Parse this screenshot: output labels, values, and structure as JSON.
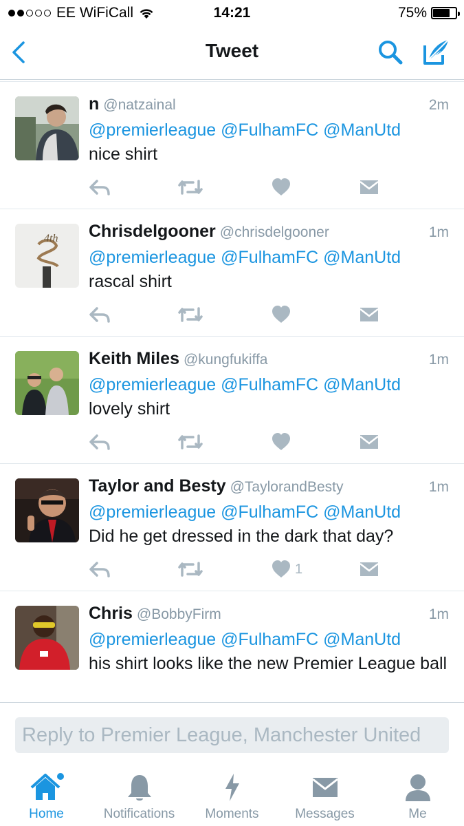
{
  "status_bar": {
    "carrier": "EE WiFiCall",
    "time": "14:21",
    "battery": "75%",
    "battery_level": 0.75,
    "signal_bars_filled": 2,
    "signal_bars_total": 5
  },
  "nav": {
    "title": "Tweet",
    "back_icon": "chevron-left-icon",
    "search_icon": "search-icon",
    "compose_icon": "compose-icon"
  },
  "colors": {
    "accent": "#1b95e0",
    "secondary_text": "#8899a6",
    "icon_gray": "#aab8c2"
  },
  "tweets": [
    {
      "name": "n",
      "handle": "@natzainal",
      "time": "2m",
      "mentions": "@premierleague @FulhamFC @ManUtd",
      "text": "nice shirt",
      "likes": ""
    },
    {
      "name": "Chrisdelgooner",
      "handle": "@chrisdelgooner",
      "time": "1m",
      "mentions": "@premierleague @FulhamFC @ManUtd",
      "text": "rascal shirt",
      "likes": ""
    },
    {
      "name": "Keith Miles",
      "handle": "@kungfukiffa",
      "time": "1m",
      "mentions": "@premierleague @FulhamFC @ManUtd",
      "text": "lovely shirt",
      "likes": ""
    },
    {
      "name": "Taylor and Besty",
      "handle": "@TaylorandBesty",
      "time": "1m",
      "mentions": "@premierleague @FulhamFC @ManUtd",
      "text": "Did he get dressed in the dark that day?",
      "likes": "1"
    },
    {
      "name": "Chris",
      "handle": "@BobbyFirm",
      "time": "1m",
      "mentions": "@premierleague @FulhamFC @ManUtd",
      "text": "his shirt looks like the new Premier League ball",
      "likes": ""
    }
  ],
  "reply": {
    "placeholder": "Reply to Premier League, Manchester United"
  },
  "tabs": [
    {
      "label": "Home",
      "icon": "home-icon",
      "active": true,
      "has_notification_dot": true
    },
    {
      "label": "Notifications",
      "icon": "bell-icon",
      "active": false
    },
    {
      "label": "Moments",
      "icon": "lightning-icon",
      "active": false
    },
    {
      "label": "Messages",
      "icon": "envelope-icon",
      "active": false
    },
    {
      "label": "Me",
      "icon": "person-icon",
      "active": false
    }
  ]
}
